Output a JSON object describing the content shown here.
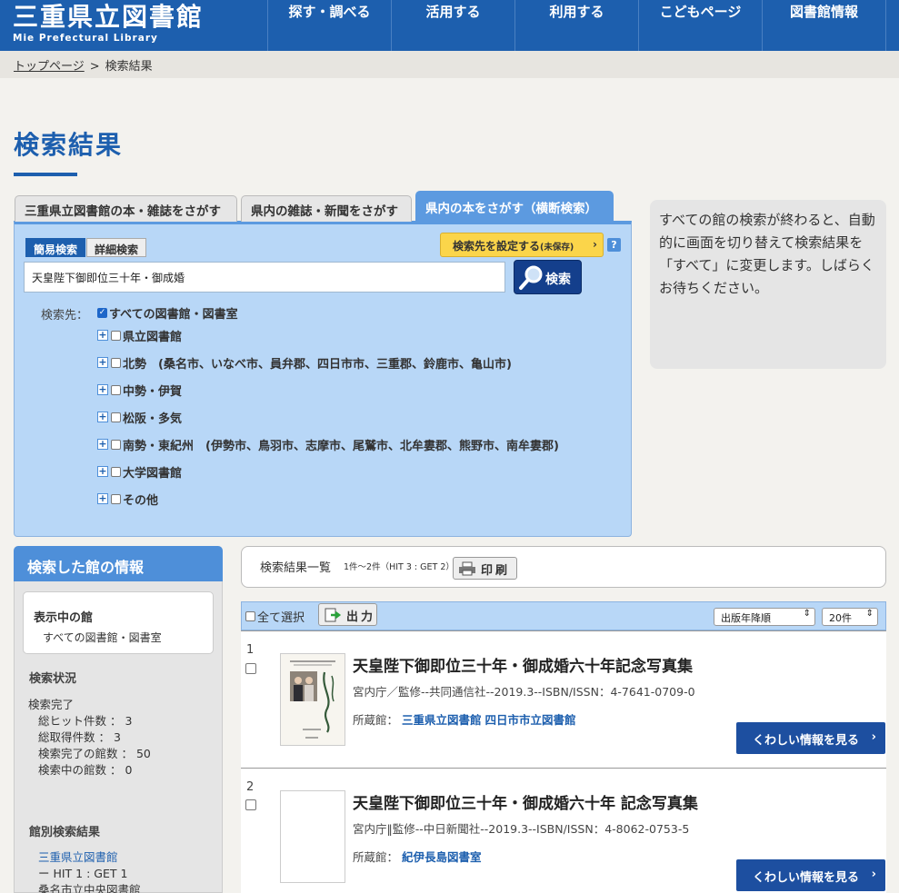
{
  "header": {
    "logo_jp": "三重県立図書館",
    "logo_en": "Mie Prefectural Library",
    "nav": [
      "探す・調べる",
      "活用する",
      "利用する",
      "こどもページ",
      "図書館情報"
    ]
  },
  "breadcrumb": {
    "home": "トップページ",
    "sep": ">",
    "current": "検索結果"
  },
  "page_title": "検索結果",
  "tabs": [
    "三重県立図書館の本・雑誌をさがす",
    "県内の雑誌・新聞をさがす",
    "県内の本をさがす（横断検索）"
  ],
  "search": {
    "mode_simple": "簡易検索",
    "mode_detail": "詳細検索",
    "set_target": "検索先を設定する",
    "set_target_note": "(未保存)",
    "help": "?",
    "query": "天皇陛下御即位三十年・御成婚",
    "button": "検索",
    "target_label": "検索先：",
    "all_libraries": "すべての図書館・図書室",
    "groups": [
      "県立図書館",
      "北勢　(桑名市、いなべ市、員弁郡、四日市市、三重郡、鈴鹿市、亀山市)",
      "中勢・伊賀",
      "松阪・多気",
      "南勢・東紀州　(伊勢市、鳥羽市、志摩市、尾鷲市、北牟婁郡、熊野市、南牟婁郡)",
      "大学図書館",
      "その他"
    ]
  },
  "notice": "すべての館の検索が終わると、自動的に画面を切り替えて検索結果を「すべて」に変更します。しばらくお待ちください。",
  "info": {
    "title": "検索した館の情報",
    "display_heading": "表示中の館",
    "display_value": "すべての図書館・図書室",
    "status_heading": "検索状況",
    "status_done": "検索完了",
    "total_hits": "総ヒット件数 ： 3",
    "total_got": "総取得件数 ： 3",
    "done_count": "検索完了の館数 ： 50",
    "running_count": "検索中の館数 ： 0",
    "per_lib_heading": "館別検索結果",
    "per_lib_name": "三重県立図書館",
    "per_lib_hits": "ー HIT 1 : GET 1",
    "per_lib_next": "桑名市立中央図書館"
  },
  "results": {
    "list_title": "検索結果一覧",
    "count": "1件〜2件（HIT 3 : GET 2）",
    "print": "印刷",
    "select_all": "全て選択",
    "output": "出力",
    "sort": "出版年降順",
    "per_page": "20件",
    "holding_label": "所蔵館：",
    "detail_button": "くわしい情報を見る",
    "items": [
      {
        "num": "1",
        "title": "天皇陛下御即位三十年・御成婚六十年記念写真集",
        "meta": "宮内庁／監修--共同通信社--2019.3--ISBN/ISSN：4-7641-0709-0",
        "holdings": [
          "三重県立図書館",
          "四日市市立図書館"
        ]
      },
      {
        "num": "2",
        "title": "天皇陛下御即位三十年・御成婚六十年 記念写真集",
        "meta": "宮内庁‖監修--中日新聞社--2019.3--ISBN/ISSN：4-8062-0753-5",
        "holdings": [
          "紀伊長島図書室"
        ]
      }
    ]
  },
  "colors": {
    "brand": "#1d5fae",
    "panel": "#b8d7f7",
    "tab_active": "#5c9ae0",
    "accent_yellow": "#fbd54a"
  }
}
